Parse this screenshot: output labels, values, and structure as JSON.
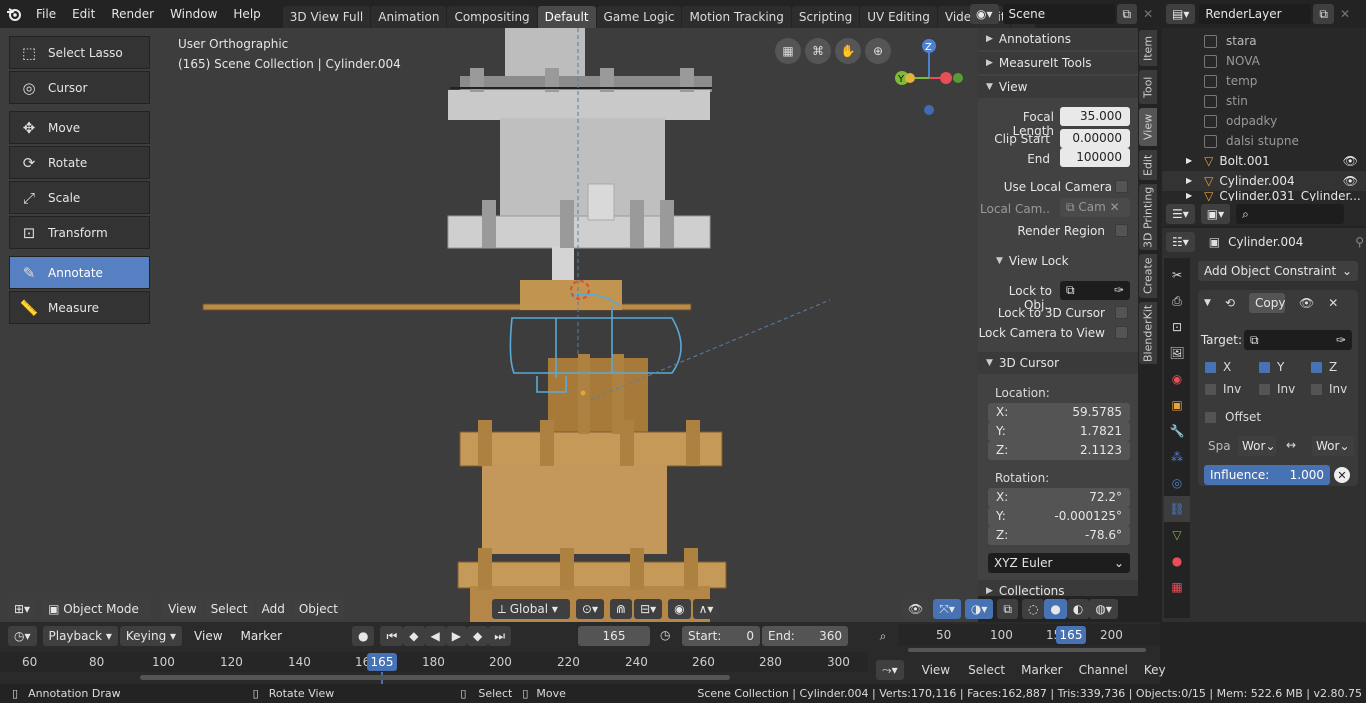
{
  "topbar": {
    "menus": [
      "File",
      "Edit",
      "Render",
      "Window",
      "Help"
    ],
    "tabs": [
      "3D View Full",
      "Animation",
      "Compositing",
      "Default",
      "Game Logic",
      "Motion Tracking",
      "Scripting",
      "UV Editing",
      "Video Editing"
    ],
    "active_tab": "Default",
    "add_tab": "+",
    "scene": "Scene",
    "render_layer": "RenderLayer"
  },
  "toolbar": {
    "tools": [
      "Select Lasso",
      "Cursor",
      "Move",
      "Rotate",
      "Scale",
      "Transform",
      "Annotate",
      "Measure"
    ],
    "active": "Annotate"
  },
  "viewport": {
    "view_name": "User Orthographic",
    "collection_info": "(165) Scene Collection | Cylinder.004",
    "header": {
      "mode": "Object Mode",
      "view": "View",
      "select": "Select",
      "add": "Add",
      "object": "Object",
      "orientation": "Global"
    },
    "gizmo": {
      "x": "X",
      "y": "Y",
      "z": "Z"
    }
  },
  "sidebar": {
    "tabs": [
      "Item",
      "Tool",
      "View",
      "Edit",
      "3D Printing",
      "Create",
      "BlenderKit"
    ],
    "active_tab": "View",
    "panels": {
      "annotations": "Annotations",
      "measureit": "MeasureIt Tools",
      "view": "View",
      "focal_length_label": "Focal Length",
      "focal_length": "35.000",
      "clip_start_label": "Clip Start",
      "clip_start": "0.00000",
      "end_label": "End",
      "end": "100000",
      "use_local_camera": "Use Local Camera",
      "local_camera_label": "Local Cam..",
      "local_camera_value": "Cam",
      "render_region": "Render Region",
      "view_lock": "View Lock",
      "lock_to_obj": "Lock to Obj..",
      "lock_3d_cursor": "Lock to 3D Cursor",
      "lock_camera": "Lock Camera to View",
      "cursor_3d": "3D Cursor",
      "location_label": "Location:",
      "loc_x": "59.5785",
      "loc_y": "1.7821",
      "loc_z": "2.1123",
      "rotation_label": "Rotation:",
      "rot_x": "72.2°",
      "rot_y": "-0.000125°",
      "rot_z": "-78.6°",
      "rot_mode": "XYZ Euler",
      "collections": "Collections",
      "x_label": "X:",
      "y_label": "Y:",
      "z_label": "Z:"
    }
  },
  "outliner": {
    "items": [
      {
        "name": "stara"
      },
      {
        "name": "NOVA"
      },
      {
        "name": "temp"
      },
      {
        "name": "stin"
      },
      {
        "name": "odpadky"
      },
      {
        "name": "dalsi stupne"
      },
      {
        "name": "Bolt.001"
      },
      {
        "name": "Cylinder.004"
      },
      {
        "name": "Cylinder.031_Cylinder..."
      }
    ]
  },
  "properties": {
    "object": "Cylinder.004",
    "add_constraint": "Add Object Constraint",
    "constraint_name": "Copy",
    "target_label": "Target:",
    "x": "X",
    "y": "Y",
    "z": "Z",
    "inv": "Inv",
    "offset": "Offset",
    "spa_label": "Spa",
    "space_a": "Wor",
    "space_b": "Wor",
    "influence_label": "Influence:",
    "influence": "1.000"
  },
  "timeline": {
    "playback": "Playback",
    "keying": "Keying",
    "view": "View",
    "marker": "Marker",
    "current_frame": "165",
    "start_label": "Start:",
    "start": "0",
    "end_label": "End:",
    "end": "360",
    "ruler": [
      "60",
      "80",
      "100",
      "120",
      "140",
      "16",
      "180",
      "200",
      "220",
      "240",
      "260",
      "280",
      "300"
    ],
    "frame_badge": "165"
  },
  "graph": {
    "ruler": [
      "50",
      "100",
      "15",
      "200"
    ],
    "frame_badge": "165",
    "view": "View",
    "select": "Select",
    "marker": "Marker",
    "channel": "Channel",
    "key": "Key"
  },
  "statusbar": {
    "annotation": "Annotation Draw",
    "rotate": "Rotate View",
    "select": "Select",
    "move": "Move",
    "stats": "Scene Collection | Cylinder.004 | Verts:170,116 | Faces:162,887 | Tris:339,736 | Objects:0/15 | Mem: 522.6 MB | v2.80.75"
  },
  "colors": {
    "accent": "#5680c2",
    "model": "#b88b4a",
    "grey_part": "#b5b5b5",
    "annotation": "#5aa9d6"
  }
}
